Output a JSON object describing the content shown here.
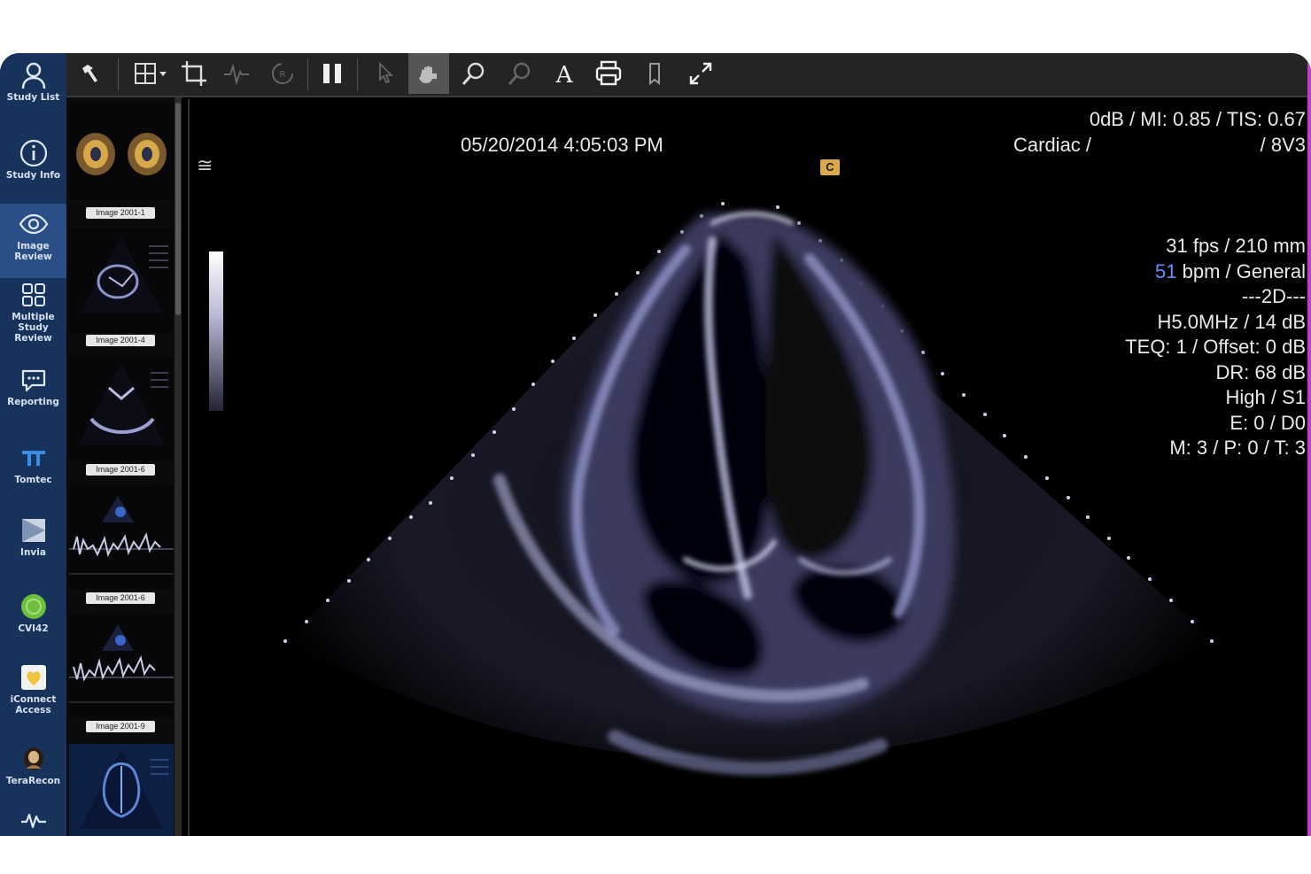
{
  "nav": {
    "items": [
      {
        "id": "study-list",
        "label": "Study List",
        "icon": "user-icon"
      },
      {
        "id": "study-info",
        "label": "Study Info",
        "icon": "info-icon"
      },
      {
        "id": "image-review",
        "label": "Image\nReview",
        "icon": "eye-icon",
        "active": true
      },
      {
        "id": "multiple-study-review",
        "label": "Multiple\nStudy\nReview",
        "icon": "grid-icon"
      },
      {
        "id": "reporting",
        "label": "Reporting",
        "icon": "chat-icon"
      },
      {
        "id": "tomtec",
        "label": "Tomtec",
        "icon": "tomtec-logo-icon"
      },
      {
        "id": "invia",
        "label": "Invia",
        "icon": "invia-logo-icon"
      },
      {
        "id": "cvi42",
        "label": "CVI42",
        "icon": "cvi42-logo-icon"
      },
      {
        "id": "iconnect-access",
        "label": "iConnect\nAccess",
        "icon": "iconnect-logo-icon"
      },
      {
        "id": "terarecon",
        "label": "TeraRecon",
        "icon": "terarecon-logo-icon"
      },
      {
        "id": "waveform",
        "label": "",
        "icon": "waveform-icon"
      }
    ]
  },
  "toolbar": {
    "tools": [
      "hammer-icon",
      "layout-grid-icon",
      "crop-icon",
      "ecg-icon",
      "rotate-icon",
      "pause-icon",
      "pointer-icon",
      "pan-hand-icon",
      "zoom-in-icon",
      "zoom-out-icon",
      "text-annotation-icon",
      "print-icon",
      "bookmark-icon",
      "fullscreen-icon"
    ]
  },
  "thumbnails": [
    {
      "label": "Image 2001-1"
    },
    {
      "label": "Image 2001-4"
    },
    {
      "label": "Image 2001-6"
    },
    {
      "label": "Image 2001-6"
    },
    {
      "label": "Image 2001-9"
    },
    {
      "label": ""
    }
  ],
  "viewer": {
    "timestamp": "05/20/2014 4:05:03 PM",
    "top_right": {
      "line1": "0dB / MI: 0.85 / TIS: 0.67",
      "line2_left": "Cardiac /",
      "line2_right": "/ 8V3"
    },
    "params": {
      "fps": "31 fps / 210 mm",
      "bpm_value": "51",
      "bpm_rest": " bpm / General",
      "mode": "---2D---",
      "freq": "H5.0MHz / 14 dB",
      "teq": "TEQ: 1 / Offset: 0 dB",
      "dr": "DR: 68 dB",
      "high": "High / S1",
      "e": "E: 0 / D0",
      "mpt": "M: 3 / P: 0 / T: 3"
    },
    "probe_marker": "C",
    "menu_glyph": "≅"
  },
  "colors": {
    "nav_bg": "#17335c",
    "nav_active": "#2a4f86",
    "toolbar_bg": "#242424",
    "accent": "#c43cc8",
    "bpm_blue": "#6a8cff"
  }
}
